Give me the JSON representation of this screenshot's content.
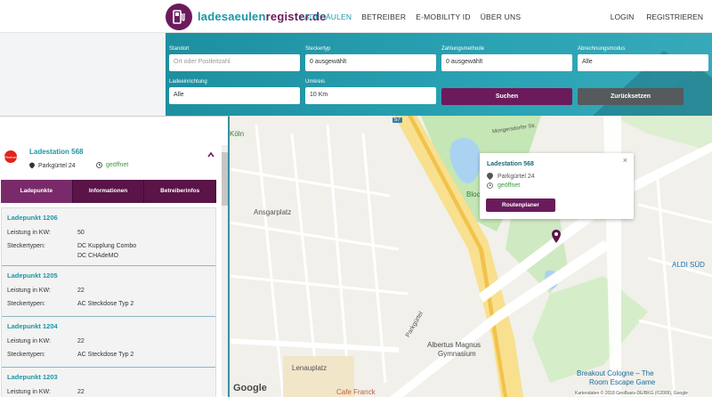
{
  "header": {
    "logo_text_a": "ladesaeulen",
    "logo_text_b": "register.de",
    "nav": [
      "LADESÄULEN",
      "BETREIBER",
      "E-MOBILITY ID",
      "ÜBER UNS"
    ],
    "login": "LOGIN",
    "register": "REGISTRIEREN"
  },
  "filters": {
    "standort": {
      "label": "Standort",
      "placeholder": "Ort oder Postleitzahl"
    },
    "steckertyp": {
      "label": "Steckertyp",
      "value": "0 ausgewählt"
    },
    "zahlungsmethode": {
      "label": "Zahlungsmethode",
      "value": "0 ausgewählt"
    },
    "abrechnungsmodus": {
      "label": "Abrechnungsmodus",
      "value": "Alle"
    },
    "ladeeinrichtung": {
      "label": "Ladeeinrichtung",
      "value": "Alle"
    },
    "umkreis": {
      "label": "Umkreis",
      "value": "10 Km"
    },
    "search_button": "Suchen",
    "reset_button": "Zurücksetzen"
  },
  "station": {
    "title": "Ladestation 568",
    "address": "Parkgürtel 24",
    "status": "geöffnet",
    "brand": "Rheinenergie",
    "tabs": [
      "Ladepunkte",
      "Informationen",
      "Betreiberinfos"
    ]
  },
  "ladepunkte": [
    {
      "title": "Ladepunkt 1206",
      "leistung_label": "Leistung in KW:",
      "leistung": "50",
      "stecker_label": "Steckertypen:",
      "stecker": [
        "DC Kupplung Combo",
        "DC CHAdeMO"
      ]
    },
    {
      "title": "Ladepunkt 1205",
      "leistung_label": "Leistung in KW:",
      "leistung": "22",
      "stecker_label": "Steckertypen:",
      "stecker": [
        "AC Steckdose Typ 2"
      ]
    },
    {
      "title": "Ladepunkt 1204",
      "leistung_label": "Leistung in KW:",
      "leistung": "22",
      "stecker_label": "Steckertypen:",
      "stecker": [
        "AC Steckdose Typ 2"
      ]
    },
    {
      "title": "Ladepunkt 1203",
      "leistung_label": "Leistung in KW:",
      "leistung": "22",
      "stecker_label": "",
      "stecker": []
    }
  ],
  "popup": {
    "title": "Ladestation 568",
    "address": "Parkgürtel 24",
    "status": "geöffnet",
    "button": "Routenplaner",
    "close": "×"
  },
  "map": {
    "labels": {
      "ansgarplatz": "Ansgarplatz",
      "lenauplatz": "Lenauplatz",
      "aldi": "ALDI SÜD",
      "albertus": "Albertus Magnus",
      "gymnasium": "Gymnasium",
      "breakout1": "Breakout Cologne – The",
      "breakout2": "Room Escape Game",
      "cafe": "Cafe Franck",
      "parkguertel": "Parkgürtel",
      "moengersdorfer": "Mongersdorfer Str.",
      "bloc": "Bloc",
      "koln": "Köln",
      "google": "Google",
      "copyright": "Kartendaten © 2018 GeoBasis-DE/BKG (©2009), Google",
      "a57": "57"
    }
  },
  "colors": {
    "brand_purple": "#6b1b5c",
    "brand_teal": "#1a97a8",
    "open_green": "#3a9a3a"
  }
}
